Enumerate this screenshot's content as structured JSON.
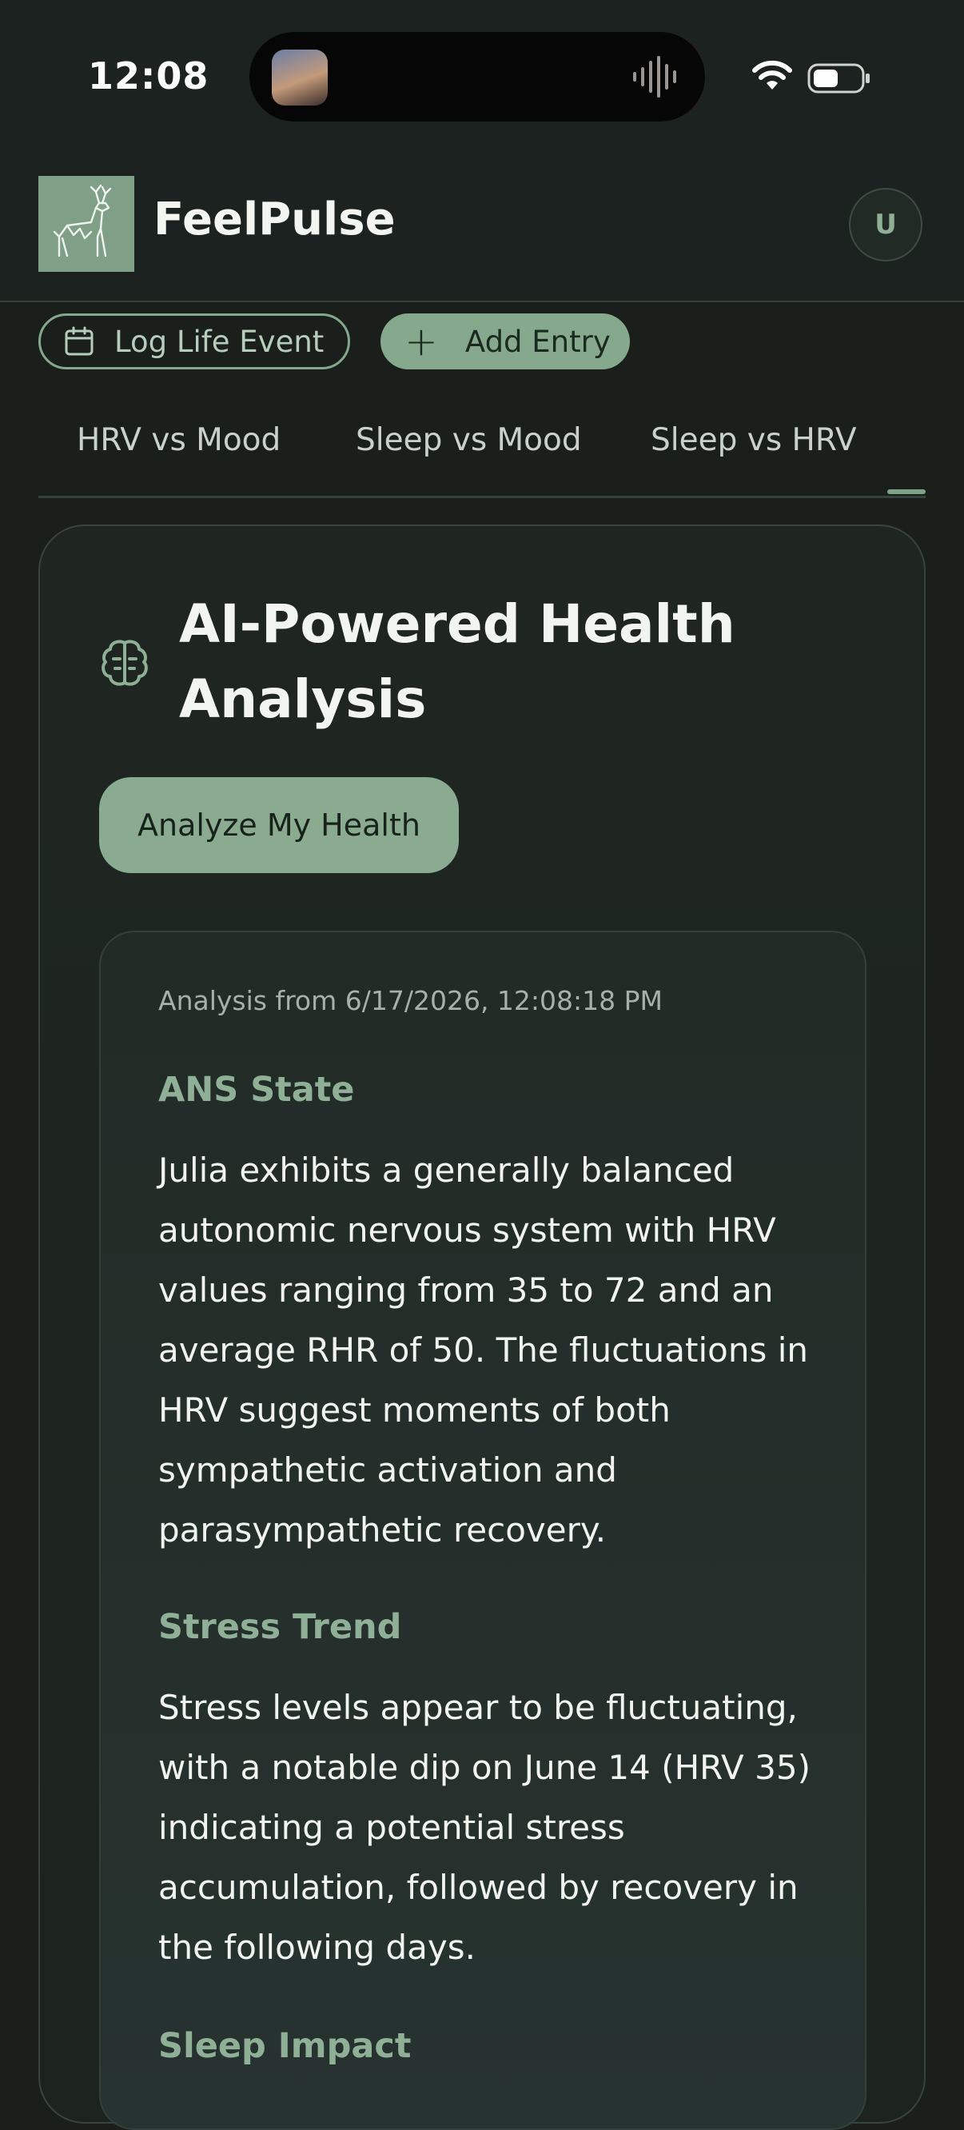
{
  "status_bar": {
    "time": "12:08",
    "icons": [
      "media-thumbnail",
      "audio-wave-icon",
      "wifi-icon",
      "battery-icon"
    ]
  },
  "header": {
    "brand": "FeelPulse",
    "avatar_initial": "U",
    "logo_icon": "deer-icon"
  },
  "actions": {
    "log_life_event": "Log Life Event",
    "add_entry": "Add Entry"
  },
  "tabs": [
    {
      "label": "HRV vs Mood"
    },
    {
      "label": "Sleep vs Mood"
    },
    {
      "label": "Sleep vs HRV"
    }
  ],
  "analysis_card": {
    "title": "AI-Powered Health Analysis",
    "button": "Analyze My Health",
    "timestamp": "Analysis from 6/17/2026, 12:08:18 PM",
    "sections": [
      {
        "heading": "ANS State",
        "body": "Julia exhibits a generally balanced autonomic nervous system with HRV values ranging from 35 to 72 and an average RHR of 50. The fluctuations in HRV suggest moments of both sympathetic activation and parasympathetic recovery."
      },
      {
        "heading": "Stress Trend",
        "body": "Stress levels appear to be fluctuating, with a notable dip on June 14 (HRV 35) indicating a potential stress accumulation, followed by recovery in the following days."
      },
      {
        "heading": "Sleep Impact",
        "body": ""
      }
    ]
  },
  "colors": {
    "background": "#1a1f1c",
    "accent": "#86a98d",
    "heading_accent": "#8fb096"
  }
}
